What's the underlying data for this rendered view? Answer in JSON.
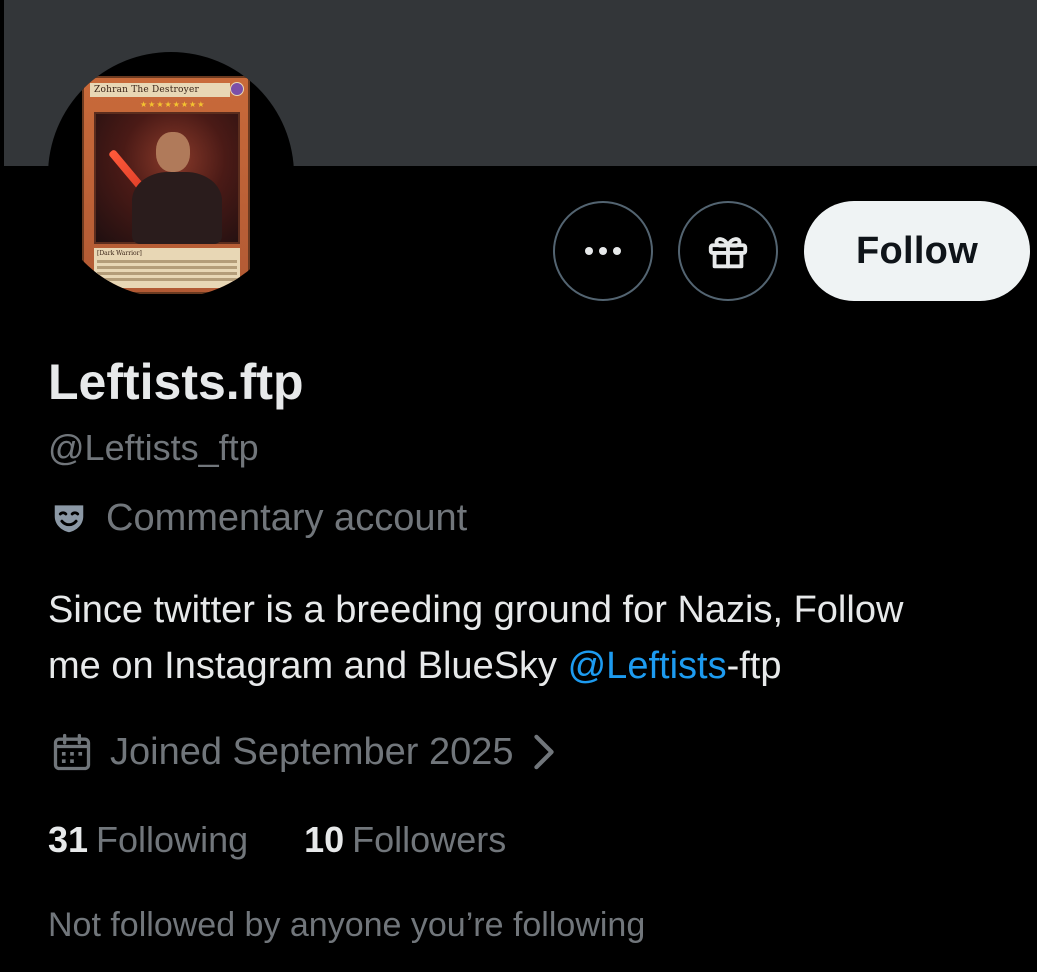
{
  "profile": {
    "display_name": "Leftists.ftp",
    "handle": "@Leftists_ftp",
    "label": "Commentary account",
    "bio": {
      "line1": "Since twitter is a breeding ground for Nazis,  Follow",
      "line2_prefix": "me on Instagram and BlueSky ",
      "mention": "@Leftists",
      "line2_suffix": "-ftp"
    },
    "joined": "Joined September 2025",
    "following_count": "31",
    "following_label": "Following",
    "followers_count": "10",
    "followers_label": "Followers",
    "social_context": "Not followed by anyone you’re following"
  },
  "avatar_card": {
    "title": "Zohran The Destroyer",
    "type_line": "[Dark Warrior]"
  },
  "actions": {
    "more_icon": "more-horizontal-icon",
    "gift_icon": "gift-icon",
    "follow_label": "Follow"
  },
  "colors": {
    "background": "#000000",
    "banner": "#333639",
    "primary_text": "#e7e9ea",
    "secondary_text": "#71767b",
    "link": "#1d9bf0",
    "button_border": "#536471",
    "follow_bg": "#eff3f4"
  }
}
